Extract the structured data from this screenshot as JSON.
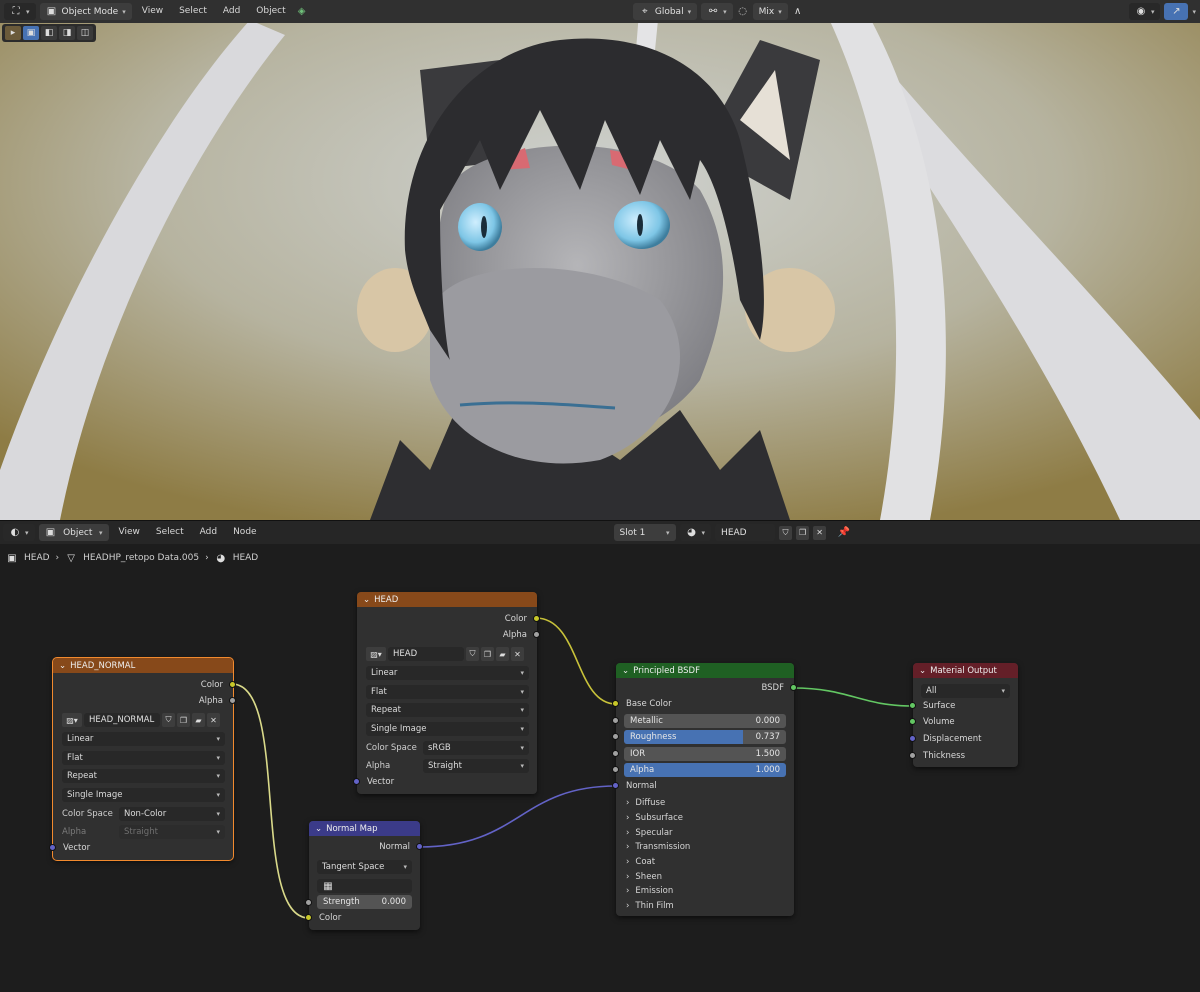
{
  "viewport": {
    "header": {
      "mode": "Object Mode",
      "menus": [
        "View",
        "Select",
        "Add",
        "Object"
      ],
      "orientation": "Global",
      "snap": "Mix"
    }
  },
  "node_editor": {
    "header": {
      "object_type": "Object",
      "menus": [
        "View",
        "Select",
        "Add",
        "Node"
      ],
      "slot": "Slot 1",
      "material": "HEAD"
    },
    "breadcrumb": [
      "HEAD",
      "HEADHP_retopo Data.005",
      "HEAD"
    ],
    "nodes": {
      "head_normal": {
        "title": "HEAD_NORMAL",
        "outputs": [
          "Color",
          "Alpha"
        ],
        "image": "HEAD_NORMAL",
        "interpolation": "Linear",
        "projection": "Flat",
        "extension": "Repeat",
        "source": "Single Image",
        "color_space_label": "Color Space",
        "color_space": "Non-Color",
        "alpha_label": "Alpha",
        "alpha": "Straight",
        "input": "Vector"
      },
      "head": {
        "title": "HEAD",
        "outputs": [
          "Color",
          "Alpha"
        ],
        "image": "HEAD",
        "interpolation": "Linear",
        "projection": "Flat",
        "extension": "Repeat",
        "source": "Single Image",
        "color_space_label": "Color Space",
        "color_space": "sRGB",
        "alpha_label": "Alpha",
        "alpha": "Straight",
        "input": "Vector"
      },
      "normal_map": {
        "title": "Normal Map",
        "output": "Normal",
        "space": "Tangent Space",
        "strength_label": "Strength",
        "strength": "0.000",
        "input": "Color"
      },
      "principled": {
        "title": "Principled BSDF",
        "output": "BSDF",
        "base_color": "Base Color",
        "metallic_label": "Metallic",
        "metallic": "0.000",
        "roughness_label": "Roughness",
        "roughness": "0.737",
        "roughness_fraction": 0.737,
        "ior_label": "IOR",
        "ior": "1.500",
        "alpha_label": "Alpha",
        "alpha": "1.000",
        "normal": "Normal",
        "panels": [
          "Diffuse",
          "Subsurface",
          "Specular",
          "Transmission",
          "Coat",
          "Sheen",
          "Emission",
          "Thin Film"
        ]
      },
      "material_output": {
        "title": "Material Output",
        "target": "All",
        "inputs": [
          "Surface",
          "Volume",
          "Displacement",
          "Thickness"
        ]
      }
    }
  }
}
